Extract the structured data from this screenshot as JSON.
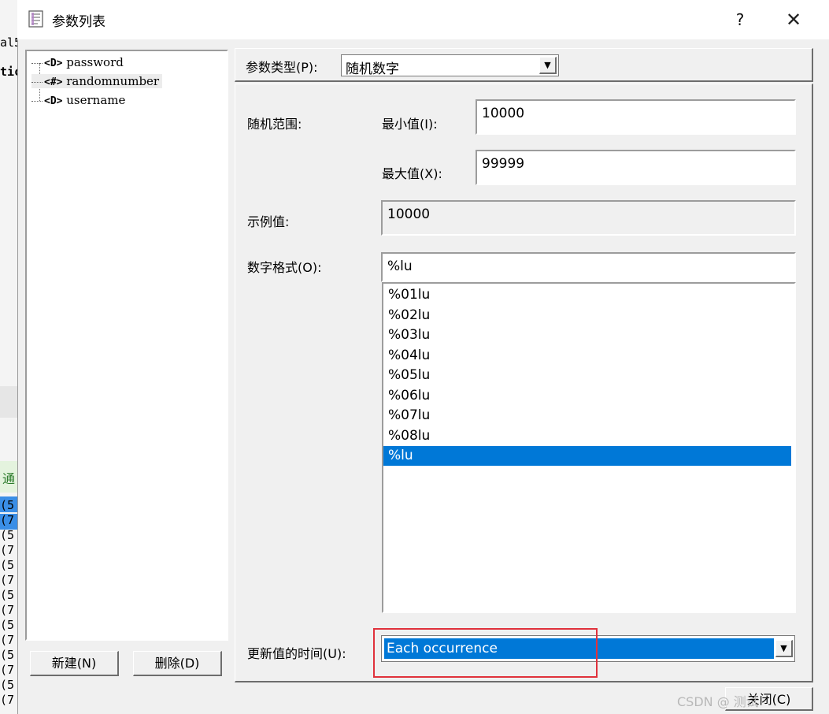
{
  "background_app": {
    "lines": [
      "al5",
      "tic"
    ],
    "code_col": [
      "(5",
      "(7",
      "(5",
      "(7",
      "(5",
      "(7",
      "(5",
      "(7",
      "(5",
      "(7",
      "(5",
      "(7",
      "(5",
      "(7"
    ],
    "tab_char": "通"
  },
  "dialog": {
    "title": "参数列表",
    "help": "?",
    "close": "✕"
  },
  "tree": {
    "items": [
      {
        "icon": "<D>",
        "label": "password"
      },
      {
        "icon": "<#>",
        "label": "randomnumber"
      },
      {
        "icon": "<D>",
        "label": "username"
      }
    ]
  },
  "buttons": {
    "new": "新建(N)",
    "delete": "删除(D)",
    "close": "关闭(C)"
  },
  "param_type": {
    "label": "参数类型(P):",
    "value": "随机数字"
  },
  "random_range": {
    "label": "随机范围:",
    "min_label": "最小值(I):",
    "min_value": "10000",
    "max_label": "最大值(X):",
    "max_value": "99999"
  },
  "sample": {
    "label": "示例值:",
    "value": "10000"
  },
  "number_format": {
    "label": "数字格式(O):",
    "value": "%lu",
    "options": [
      "%01lu",
      "%02lu",
      "%03lu",
      "%04lu",
      "%05lu",
      "%06lu",
      "%07lu",
      "%08lu",
      "%lu"
    ],
    "selected": "%lu"
  },
  "update": {
    "label": "更新值的时间(U):",
    "value": "Each occurrence"
  },
  "watermark": "CSDN @ 测试"
}
